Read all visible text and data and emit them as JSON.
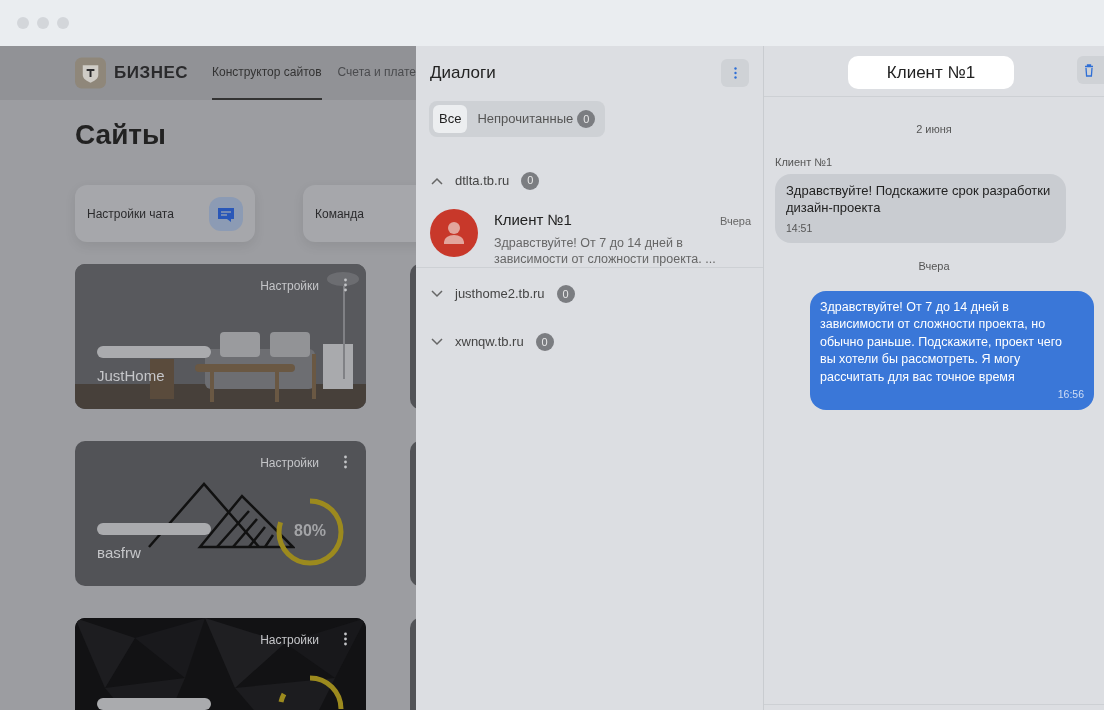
{
  "header": {
    "brand": "БИЗНЕС",
    "nav": [
      {
        "label": "Конструктор сайтов",
        "selected": true
      },
      {
        "label": "Счета и плате",
        "selected": false
      }
    ]
  },
  "page_title": "Сайты",
  "quick_actions": [
    {
      "label": "Настройки чата",
      "kind": "chat"
    },
    {
      "label": "Команда",
      "kind": "plain"
    }
  ],
  "sites": [
    {
      "settings": "Настройки",
      "name": "JustHome"
    },
    {
      "kind": "logo",
      "settings": "Настройки",
      "name": "вasfrw",
      "progress": {
        "level": 0.8,
        "reading": "80%"
      }
    },
    {
      "kind": "pattern",
      "settings": "Настройки",
      "ring_cut_off": true
    }
  ],
  "dialogs": {
    "title": "Диалоги",
    "filters": [
      {
        "label": "Все",
        "selected": true
      },
      {
        "label": "Непрочитанные",
        "count": "0",
        "selected": false
      }
    ],
    "groups": [
      {
        "domain": "dtlta.tb.ru",
        "count": "0",
        "expanded": true,
        "chats": [
          {
            "name": "Клиент №1",
            "time": "Вчера",
            "preview": "Здравствуйте! От 7 до 14 дней в зависимости от сложности проекта. ..."
          }
        ]
      },
      {
        "domain": "justhome2.tb.ru",
        "count": "0",
        "expanded": false
      },
      {
        "domain": "xwnqw.tb.ru",
        "count": "0",
        "expanded": false
      }
    ]
  },
  "chat": {
    "title": "Клиент №1",
    "messages": [
      {
        "kind": "date",
        "text": "2 июня"
      },
      {
        "kind": "incoming",
        "sender": "Клиент №1",
        "text": "Здравствуйте! Подскажите срок разработки дизайн-проекта",
        "time": "14:51"
      },
      {
        "kind": "date",
        "text": "Вчера"
      },
      {
        "kind": "outgoing",
        "text": "Здравствуйте! От 7 до 14 дней в зависимости от сложности проекта, но обычно раньше. Подскажите, проект чего вы хотели бы рассмотреть. Я могу рассчитать для вас точное время",
        "time": "16:56"
      }
    ]
  }
}
